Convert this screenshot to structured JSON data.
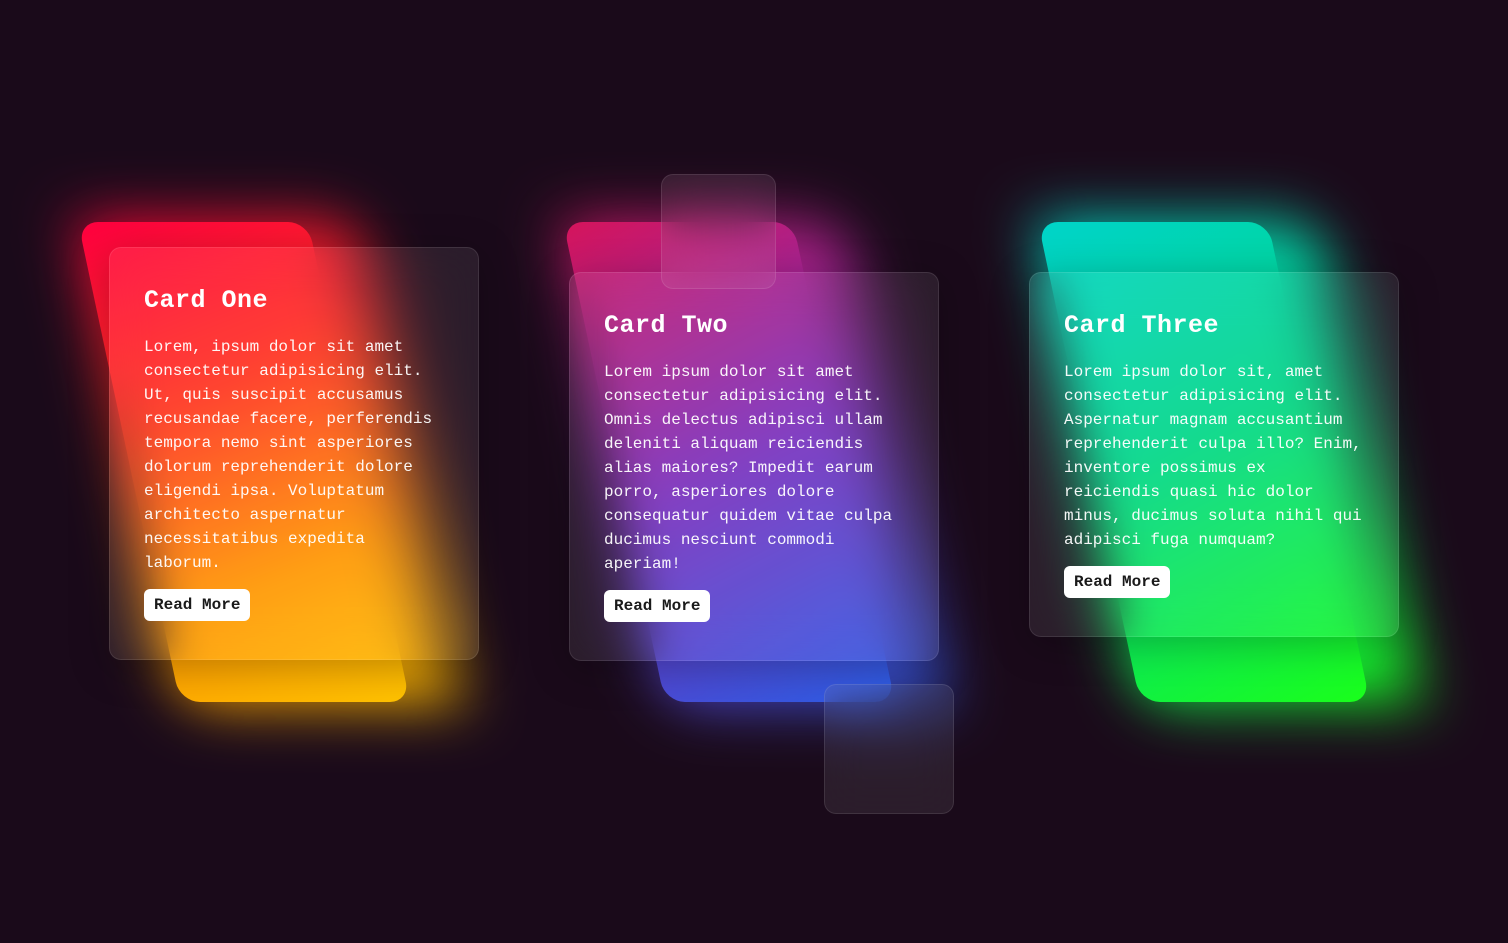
{
  "cards": [
    {
      "title": "Card One",
      "body": "Lorem, ipsum dolor sit amet consectetur adipisicing elit. Ut, quis suscipit accusamus recusandae facere, perferendis tempora nemo sint asperiores dolorum reprehenderit dolore eligendi ipsa. Voluptatum architecto aspernatur necessitatibus expedita laborum.",
      "cta": "Read More"
    },
    {
      "title": "Card Two",
      "body": "Lorem ipsum dolor sit amet consectetur adipisicing elit. Omnis delectus adipisci ullam deleniti aliquam reiciendis alias maiores? Impedit earum porro, asperiores dolore consequatur quidem vitae culpa ducimus nesciunt commodi aperiam!",
      "cta": "Read More"
    },
    {
      "title": "Card Three",
      "body": "Lorem ipsum dolor sit, amet consectetur adipisicing elit. Aspernatur magnam accusantium reprehenderit culpa illo? Enim, inventore possimus ex reiciendis quasi hic dolor minus, ducimus soluta nihil qui adipisci fuga numquam?",
      "cta": "Read More"
    }
  ]
}
